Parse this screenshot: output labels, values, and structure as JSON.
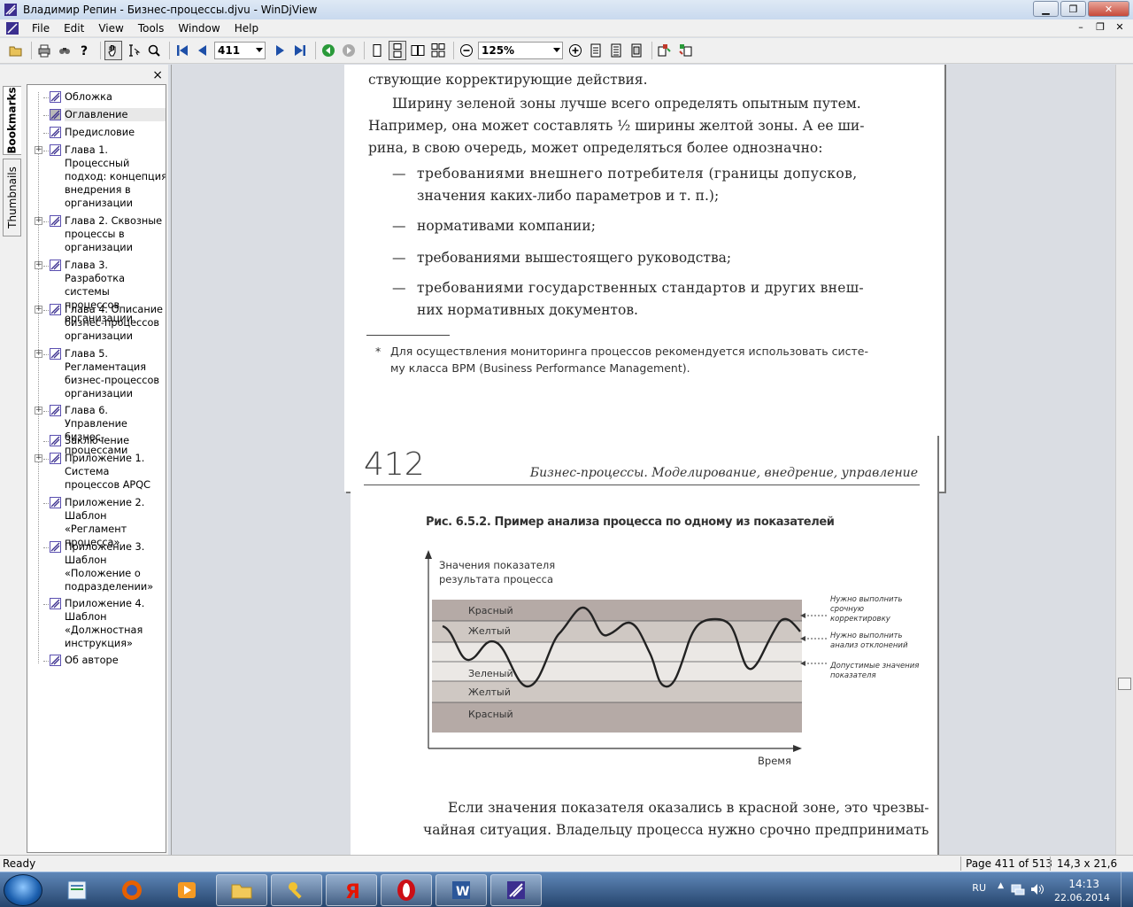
{
  "window": {
    "title": "Владимир Репин - Бизнес-процессы.djvu - WinDjView",
    "min_label": "▁",
    "restore_label": "❐",
    "close_label": "✕"
  },
  "menu": {
    "items": [
      "File",
      "Edit",
      "View",
      "Tools",
      "Window",
      "Help"
    ],
    "mdi_min": "–",
    "mdi_restore": "❐",
    "mdi_close": "✕"
  },
  "toolbar": {
    "page_value": "411",
    "zoom_value": "125%",
    "icons": [
      "open-icon",
      "print-icon",
      "find-icon",
      "help-icon",
      "hand-tool-icon",
      "select-text-icon",
      "zoom-rect-icon",
      "first-page-icon",
      "prev-page-icon",
      "next-page-icon",
      "last-page-icon",
      "back-icon",
      "forward-icon",
      "single-page-icon",
      "continuous-icon",
      "facing-icon",
      "continuous-facing-icon",
      "zoom-out-icon",
      "zoom-in-icon",
      "fit-page-icon",
      "fit-width-icon",
      "actual-size-icon",
      "rotate-left-icon",
      "rotate-right-icon"
    ]
  },
  "sidetabs": {
    "bookmarks": "Bookmarks",
    "thumbnails": "Thumbnails"
  },
  "bookmarks": {
    "close_label": "×",
    "items": [
      {
        "label": "Обложка",
        "expandable": false
      },
      {
        "label": "Оглавление",
        "expandable": false,
        "selected": true
      },
      {
        "label": "Предисловие",
        "expandable": false
      },
      {
        "label": "Глава 1. Процессный подход: концепция внедрения в организации",
        "expandable": true
      },
      {
        "label": "Глава 2. Сквозные процессы в организации",
        "expandable": true
      },
      {
        "label": "Глава 3. Разработка системы процессов организации",
        "expandable": true
      },
      {
        "label": "Глава 4. Описание бизнес-процессов организации",
        "expandable": true
      },
      {
        "label": "Глава 5. Регламентация бизнес-процессов организации",
        "expandable": true
      },
      {
        "label": "Глава 6. Управление бизнес-процессами",
        "expandable": true
      },
      {
        "label": "Заключение",
        "expandable": false
      },
      {
        "label": "Приложение 1. Система процессов APQC",
        "expandable": true
      },
      {
        "label": "Приложение 2. Шаблон «Регламент процесса»",
        "expandable": false
      },
      {
        "label": "Приложение 3. Шаблон «Положение о подразделении»",
        "expandable": false
      },
      {
        "label": "Приложение 4. Шаблон «Должностная инструкция»",
        "expandable": false
      },
      {
        "label": "Об авторе",
        "expandable": false
      }
    ]
  },
  "page411": {
    "lines": [
      "ствующие корректирующие действия.",
      "Ширину зеленой зоны лучше всего определять опытным путем.",
      "Например, она может составлять ½ ширины желтой зоны. А ее ши-",
      "рина, в свою очередь, может определяться более однозначно:",
      "требованиями внешнего потребителя (границы допусков,",
      "значения каких-либо параметров и т. п.);",
      "нормативами компании;",
      "требованиями вышестоящего руководства;",
      "требованиями государственных стандартов и других внеш-",
      "них нормативных документов."
    ],
    "dash": "—",
    "footnote_mark": "*",
    "footnote_1": "Для осуществления мониторинга процессов рекомендуется использовать систе-",
    "footnote_2": "му класса BPM (Business Performance Management)."
  },
  "page412": {
    "number": "412",
    "running_head": "Бизнес-процессы. Моделирование, внедрение, управление",
    "figure_caption": "Рис. 6.5.2. Пример анализа процесса по одному из показателей",
    "body_1": "Если значения показателя оказались в красной зоне, это чрезвы-",
    "body_2": "чайная ситуация. Владельцу процесса нужно срочно предпринимать"
  },
  "chart_data": {
    "type": "line",
    "ylabel_1": "Значения показателя",
    "ylabel_2": "результата процесса",
    "xlabel": "Время",
    "zones": [
      "Красный",
      "Желтый",
      "Зеленый",
      "Желтый",
      "Красный"
    ],
    "annotations": [
      {
        "lines": [
          "Нужно выполнить",
          "срочную",
          "корректировку"
        ]
      },
      {
        "lines": [
          "Нужно выполнить",
          "анализ отклонений"
        ]
      },
      {
        "lines": [
          "Допустимые значения",
          "показателя"
        ]
      }
    ]
  },
  "status": {
    "ready": "Ready",
    "page": "Page 411 of 513",
    "size": "14,3 x 21,6 cm"
  },
  "taskbar": {
    "apps": [
      "explorer-icon",
      "firefox-icon",
      "media-player-icon",
      "folder-icon",
      "tools-icon",
      "yandex-icon",
      "opera-icon",
      "word-icon",
      "windjview-icon"
    ],
    "lang": "RU",
    "time": "14:13",
    "date": "22.06.2014"
  }
}
